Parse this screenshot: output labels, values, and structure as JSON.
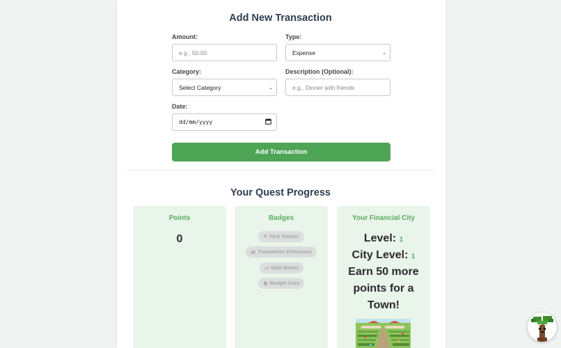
{
  "form": {
    "title": "Add New Transaction",
    "amount_label": "Amount:",
    "amount_placeholder": "e.g., 50.00",
    "type_label": "Type:",
    "type_value": "Expense",
    "category_label": "Category:",
    "category_value": "Select Category",
    "description_label": "Description (Optional):",
    "description_placeholder": "e.g., Dinner with friends",
    "date_label": "Date:",
    "date_value": "dd/mm/yyyy",
    "submit_label": "Add Transaction"
  },
  "progress": {
    "title": "Your Quest Progress",
    "points": {
      "title": "Points",
      "value": "0"
    },
    "badges": {
      "title": "Badges",
      "items": [
        {
          "icon": "pen-icon",
          "label": "First Tracker"
        },
        {
          "icon": "bar-chart-icon",
          "label": "Transaction Enthusiast"
        },
        {
          "icon": "line-chart-icon",
          "label": "Data Master"
        },
        {
          "icon": "money-bag-icon",
          "label": "Budget Guru"
        }
      ]
    },
    "city": {
      "title": "Your Financial City",
      "level_label": "Level:",
      "level_value": "1",
      "city_level_label": "City Level:",
      "city_level_value": "1",
      "next_line1": "Earn 50 more",
      "next_line2": "points for a",
      "next_line3": "Town!"
    }
  },
  "colors": {
    "accent": "#4ea556",
    "accent_text": "#5aad5f",
    "panel_bg": "#e9f4ea",
    "heading": "#2c3e50"
  }
}
